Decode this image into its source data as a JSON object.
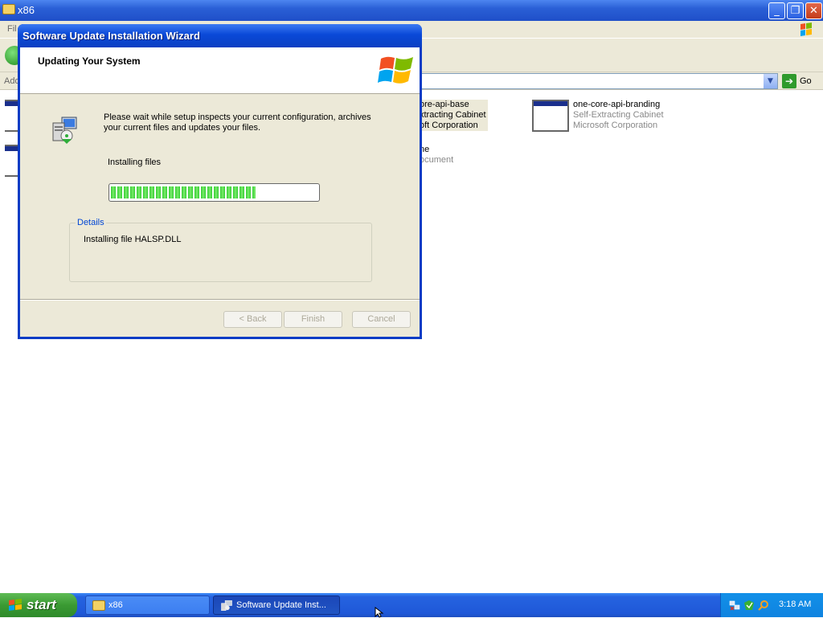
{
  "explorer": {
    "title": "x86",
    "menu_first": "Fil",
    "address_label": "Add",
    "go_label": "Go",
    "files": [
      {
        "name": "ore-api-base",
        "type": "xtracting Cabinet",
        "company": "oft Corporation"
      },
      {
        "name": "one-core-api-branding",
        "type": "Self-Extracting Cabinet",
        "company": "Microsoft Corporation"
      },
      {
        "name": "ne",
        "type": "ocument"
      }
    ]
  },
  "wizard": {
    "title": "Software Update Installation Wizard",
    "header_title": "Updating Your System",
    "description": "Please wait while setup inspects your current configuration, archives your current files and updates your files.",
    "status_label": "Installing files",
    "progress": 0.7,
    "details_legend": "Details",
    "details_text": "Installing file HALSP.DLL",
    "buttons": {
      "back": "< Back",
      "finish": "Finish",
      "cancel": "Cancel"
    }
  },
  "taskbar": {
    "start_label": "start",
    "tasks": [
      {
        "label": "x86"
      },
      {
        "label": "Software Update Inst..."
      }
    ],
    "clock": "3:18 AM"
  },
  "colors": {
    "title_blue": "#0a49d8",
    "taskbar_blue": "#2563e0",
    "start_green": "#3a9a33",
    "progress_green": "#33cc33",
    "details_legend_blue": "#0046d5"
  }
}
